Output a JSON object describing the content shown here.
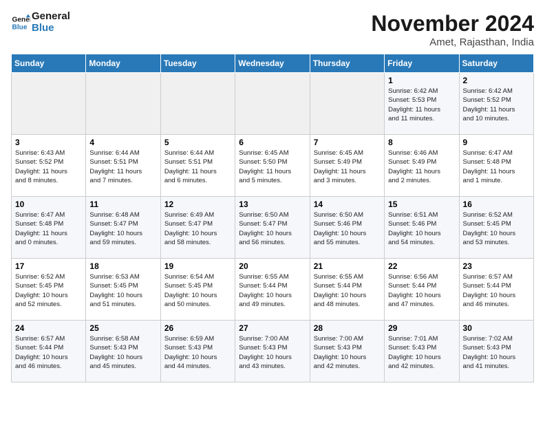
{
  "logo": {
    "line1": "General",
    "line2": "Blue"
  },
  "title": "November 2024",
  "subtitle": "Amet, Rajasthan, India",
  "headers": [
    "Sunday",
    "Monday",
    "Tuesday",
    "Wednesday",
    "Thursday",
    "Friday",
    "Saturday"
  ],
  "weeks": [
    [
      {
        "day": "",
        "info": ""
      },
      {
        "day": "",
        "info": ""
      },
      {
        "day": "",
        "info": ""
      },
      {
        "day": "",
        "info": ""
      },
      {
        "day": "",
        "info": ""
      },
      {
        "day": "1",
        "info": "Sunrise: 6:42 AM\nSunset: 5:53 PM\nDaylight: 11 hours\nand 11 minutes."
      },
      {
        "day": "2",
        "info": "Sunrise: 6:42 AM\nSunset: 5:52 PM\nDaylight: 11 hours\nand 10 minutes."
      }
    ],
    [
      {
        "day": "3",
        "info": "Sunrise: 6:43 AM\nSunset: 5:52 PM\nDaylight: 11 hours\nand 8 minutes."
      },
      {
        "day": "4",
        "info": "Sunrise: 6:44 AM\nSunset: 5:51 PM\nDaylight: 11 hours\nand 7 minutes."
      },
      {
        "day": "5",
        "info": "Sunrise: 6:44 AM\nSunset: 5:51 PM\nDaylight: 11 hours\nand 6 minutes."
      },
      {
        "day": "6",
        "info": "Sunrise: 6:45 AM\nSunset: 5:50 PM\nDaylight: 11 hours\nand 5 minutes."
      },
      {
        "day": "7",
        "info": "Sunrise: 6:45 AM\nSunset: 5:49 PM\nDaylight: 11 hours\nand 3 minutes."
      },
      {
        "day": "8",
        "info": "Sunrise: 6:46 AM\nSunset: 5:49 PM\nDaylight: 11 hours\nand 2 minutes."
      },
      {
        "day": "9",
        "info": "Sunrise: 6:47 AM\nSunset: 5:48 PM\nDaylight: 11 hours\nand 1 minute."
      }
    ],
    [
      {
        "day": "10",
        "info": "Sunrise: 6:47 AM\nSunset: 5:48 PM\nDaylight: 11 hours\nand 0 minutes."
      },
      {
        "day": "11",
        "info": "Sunrise: 6:48 AM\nSunset: 5:47 PM\nDaylight: 10 hours\nand 59 minutes."
      },
      {
        "day": "12",
        "info": "Sunrise: 6:49 AM\nSunset: 5:47 PM\nDaylight: 10 hours\nand 58 minutes."
      },
      {
        "day": "13",
        "info": "Sunrise: 6:50 AM\nSunset: 5:47 PM\nDaylight: 10 hours\nand 56 minutes."
      },
      {
        "day": "14",
        "info": "Sunrise: 6:50 AM\nSunset: 5:46 PM\nDaylight: 10 hours\nand 55 minutes."
      },
      {
        "day": "15",
        "info": "Sunrise: 6:51 AM\nSunset: 5:46 PM\nDaylight: 10 hours\nand 54 minutes."
      },
      {
        "day": "16",
        "info": "Sunrise: 6:52 AM\nSunset: 5:45 PM\nDaylight: 10 hours\nand 53 minutes."
      }
    ],
    [
      {
        "day": "17",
        "info": "Sunrise: 6:52 AM\nSunset: 5:45 PM\nDaylight: 10 hours\nand 52 minutes."
      },
      {
        "day": "18",
        "info": "Sunrise: 6:53 AM\nSunset: 5:45 PM\nDaylight: 10 hours\nand 51 minutes."
      },
      {
        "day": "19",
        "info": "Sunrise: 6:54 AM\nSunset: 5:45 PM\nDaylight: 10 hours\nand 50 minutes."
      },
      {
        "day": "20",
        "info": "Sunrise: 6:55 AM\nSunset: 5:44 PM\nDaylight: 10 hours\nand 49 minutes."
      },
      {
        "day": "21",
        "info": "Sunrise: 6:55 AM\nSunset: 5:44 PM\nDaylight: 10 hours\nand 48 minutes."
      },
      {
        "day": "22",
        "info": "Sunrise: 6:56 AM\nSunset: 5:44 PM\nDaylight: 10 hours\nand 47 minutes."
      },
      {
        "day": "23",
        "info": "Sunrise: 6:57 AM\nSunset: 5:44 PM\nDaylight: 10 hours\nand 46 minutes."
      }
    ],
    [
      {
        "day": "24",
        "info": "Sunrise: 6:57 AM\nSunset: 5:44 PM\nDaylight: 10 hours\nand 46 minutes."
      },
      {
        "day": "25",
        "info": "Sunrise: 6:58 AM\nSunset: 5:43 PM\nDaylight: 10 hours\nand 45 minutes."
      },
      {
        "day": "26",
        "info": "Sunrise: 6:59 AM\nSunset: 5:43 PM\nDaylight: 10 hours\nand 44 minutes."
      },
      {
        "day": "27",
        "info": "Sunrise: 7:00 AM\nSunset: 5:43 PM\nDaylight: 10 hours\nand 43 minutes."
      },
      {
        "day": "28",
        "info": "Sunrise: 7:00 AM\nSunset: 5:43 PM\nDaylight: 10 hours\nand 42 minutes."
      },
      {
        "day": "29",
        "info": "Sunrise: 7:01 AM\nSunset: 5:43 PM\nDaylight: 10 hours\nand 42 minutes."
      },
      {
        "day": "30",
        "info": "Sunrise: 7:02 AM\nSunset: 5:43 PM\nDaylight: 10 hours\nand 41 minutes."
      }
    ]
  ]
}
